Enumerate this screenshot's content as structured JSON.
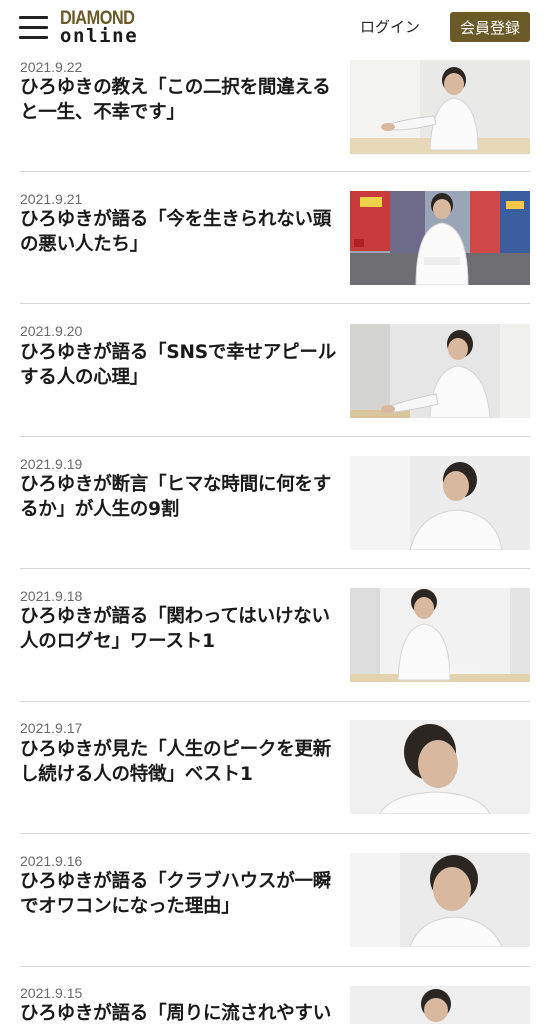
{
  "header": {
    "logo_line1": "DIAMOND",
    "logo_line2": "online",
    "login_label": "ログイン",
    "register_label": "会員登録",
    "brand_color": "#6b5a27"
  },
  "articles": [
    {
      "date": "2021.9.22",
      "title": "ひろゆきの教え「この二択を間違えると一生、不幸です」"
    },
    {
      "date": "2021.9.21",
      "title": "ひろゆきが語る「今を生きられない頭の悪い人たち」"
    },
    {
      "date": "2021.9.20",
      "title": "ひろゆきが語る「SNSで幸せアピールする人の心理」"
    },
    {
      "date": "2021.9.19",
      "title": "ひろゆきが断言「ヒマな時間に何をするか」が人生の9割"
    },
    {
      "date": "2021.9.18",
      "title": "ひろゆきが語る「関わってはいけない人のログセ」ワースト1"
    },
    {
      "date": "2021.9.17",
      "title": "ひろゆきが見た「人生のピークを更新し続ける人の特徴」ベスト1"
    },
    {
      "date": "2021.9.16",
      "title": "ひろゆきが語る「クラブハウスが一瞬でオワコンになった理由」"
    },
    {
      "date": "2021.9.15",
      "title": "ひろゆきが語る「周りに流されやすい"
    }
  ]
}
